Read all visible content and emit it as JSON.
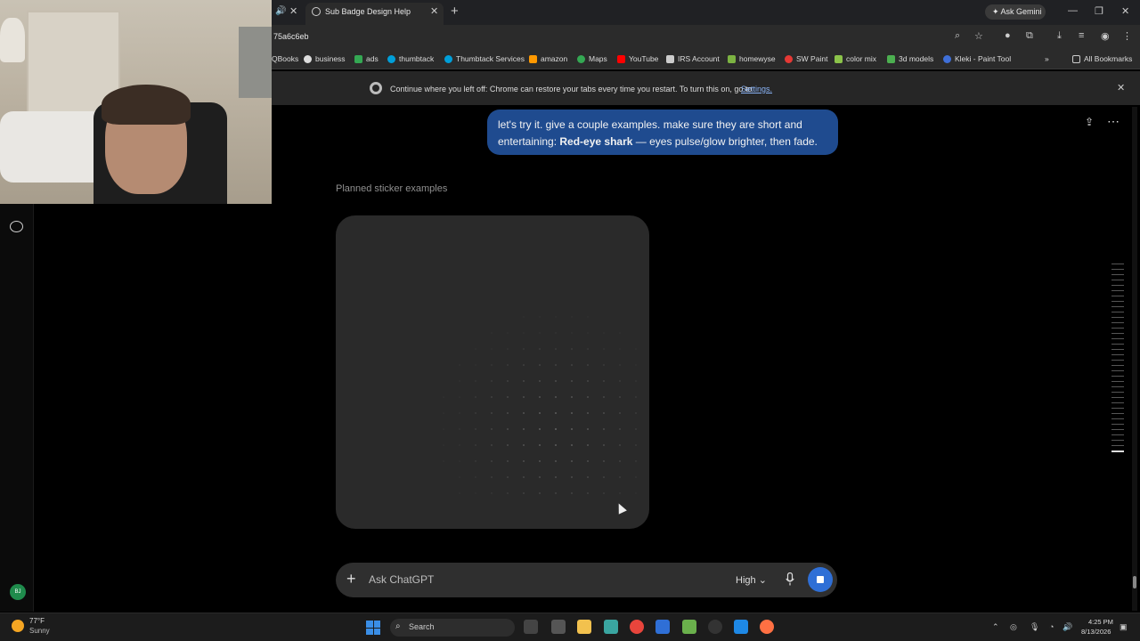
{
  "browser": {
    "tab_title": "Sub Badge Design Help",
    "ask_gemini": "Ask Gemini",
    "url": "75a6c6eb",
    "bookmarks": [
      "QBooks",
      "business",
      "ads",
      "thumbtack",
      "Thumbtack Services",
      "amazon",
      "Maps",
      "YouTube",
      "IRS Account",
      "homewyse",
      "SW Paint",
      "color mix",
      "3d models",
      "Kleki - Paint Tool"
    ],
    "all_bookmarks": "All Bookmarks",
    "infobar_text": "Continue where you left off: Chrome can restore your tabs every time you restart. To turn this on, go to",
    "infobar_link": "Settings."
  },
  "sidebar": {
    "avatar_initials": "BJ"
  },
  "chat": {
    "user_message_prefix": "let's try it. give a couple examples. make sure they are short and entertaining: ",
    "user_message_bold": "Red-eye shark",
    "user_message_suffix": " — eyes pulse/glow brighter, then fade.",
    "planned_label": "Planned sticker examples"
  },
  "composer": {
    "placeholder": "Ask ChatGPT",
    "model": "High"
  },
  "taskbar": {
    "weather_temp": "77°F",
    "weather_cond": "Sunny",
    "search": "Search",
    "time": "4:25 PM",
    "date": "8/13/2026"
  },
  "colors": {
    "user_bubble": "#1f4b8f",
    "stop_button": "#2f6fd6",
    "card_bg": "#2a2a2a"
  }
}
